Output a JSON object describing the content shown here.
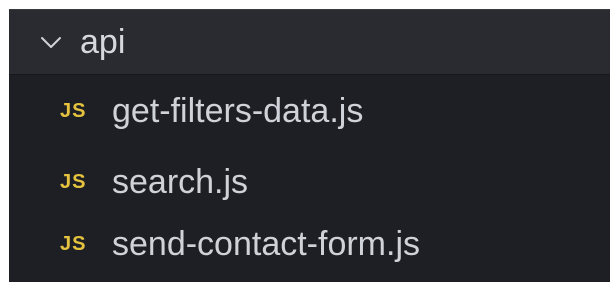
{
  "folder": {
    "name": "api",
    "expanded": true,
    "chevron_icon": "chevron-down-icon"
  },
  "files": [
    {
      "icon_label": "JS",
      "name": "get-filters-data.js"
    },
    {
      "icon_label": "JS",
      "name": "search.js"
    },
    {
      "icon_label": "JS",
      "name": "send-contact-form.js"
    }
  ],
  "colors": {
    "panel_bg": "#1e1f24",
    "folder_row_bg": "#2a2b30",
    "text": "#cfd2d8",
    "js_icon": "#e5c33e"
  }
}
